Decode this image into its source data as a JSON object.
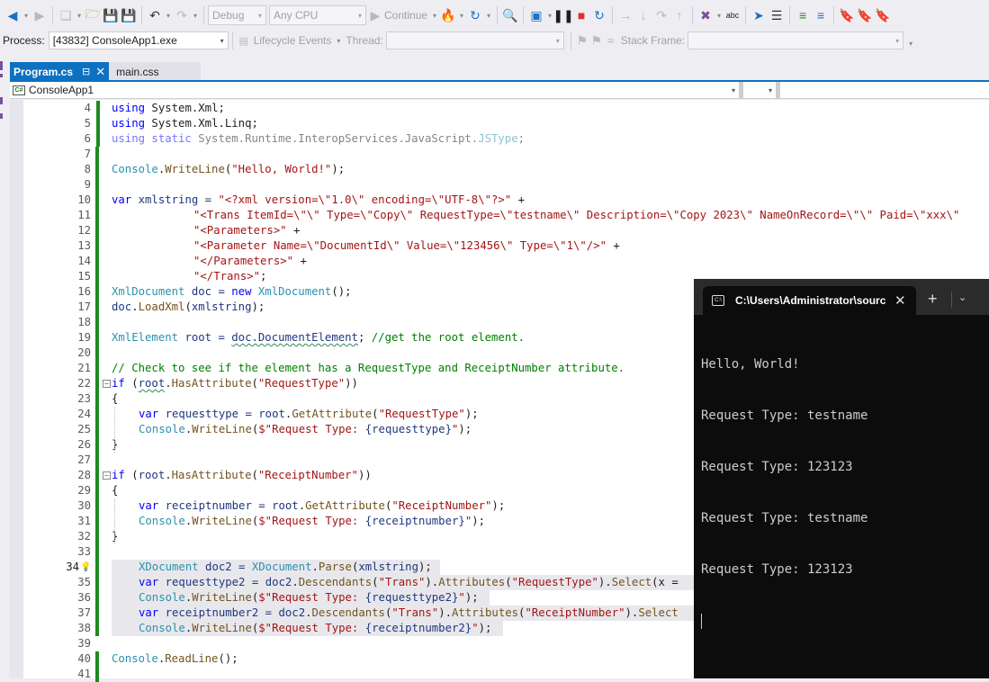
{
  "toolbar": {
    "configuration": "Debug",
    "platform": "Any CPU",
    "continue_label": "Continue"
  },
  "debugbar": {
    "process_label": "Process:",
    "process_value": "[43832] ConsoleApp1.exe",
    "lifecycle_label": "Lifecycle Events",
    "thread_label": "Thread:",
    "thread_value": "",
    "stackframe_label": "Stack Frame:",
    "stackframe_value": ""
  },
  "tabs": [
    {
      "label": "Program.cs",
      "active": true
    },
    {
      "label": "main.css",
      "active": false
    }
  ],
  "navbar": {
    "project": "ConsoleApp1",
    "type_member": "",
    "member": ""
  },
  "editor": {
    "lines": [
      {
        "n": "4"
      },
      {
        "n": "5"
      },
      {
        "n": "6"
      },
      {
        "n": "7"
      },
      {
        "n": "8"
      },
      {
        "n": "9"
      },
      {
        "n": "10"
      },
      {
        "n": "11"
      },
      {
        "n": "12"
      },
      {
        "n": "13"
      },
      {
        "n": "14"
      },
      {
        "n": "15"
      },
      {
        "n": "16"
      },
      {
        "n": "17"
      },
      {
        "n": "18"
      },
      {
        "n": "19"
      },
      {
        "n": "20"
      },
      {
        "n": "21"
      },
      {
        "n": "22"
      },
      {
        "n": "23"
      },
      {
        "n": "24"
      },
      {
        "n": "25"
      },
      {
        "n": "26"
      },
      {
        "n": "27"
      },
      {
        "n": "28"
      },
      {
        "n": "29"
      },
      {
        "n": "30"
      },
      {
        "n": "31"
      },
      {
        "n": "32"
      },
      {
        "n": "33"
      },
      {
        "n": "34"
      },
      {
        "n": "35"
      },
      {
        "n": "36"
      },
      {
        "n": "37"
      },
      {
        "n": "38"
      },
      {
        "n": "39"
      },
      {
        "n": "40"
      },
      {
        "n": "41"
      }
    ],
    "code": {
      "l4": [
        "using",
        " System.Xml;"
      ],
      "l5": [
        "using",
        " System.Xml.Linq;"
      ],
      "l6": [
        "using static",
        " System.Runtime.InteropServices.JavaScript.",
        "JSType",
        ";"
      ],
      "l8": [
        "Console",
        ".",
        "WriteLine",
        "(",
        "\"Hello, World!\"",
        ");"
      ],
      "l10": [
        "var",
        " xmlstring = ",
        "\"<?xml version=\\\"1.0\\\" encoding=\\\"UTF-8\\\"?>\"",
        " +"
      ],
      "l11": [
        "\"<Trans ItemId=\\\"\\\" Type=\\\"Copy\\\" RequestType=\\\"testname\\\" Description=\\\"Copy 2023\\\" NameOnRecord=\\\"\\\" Paid=\\\"xxx\\\""
      ],
      "l12": [
        "\"<Parameters>\"",
        " +"
      ],
      "l13": [
        "\"<Parameter Name=\\\"DocumentId\\\" Value=\\\"123456\\\" Type=\\\"1\\\"/>\"",
        " +"
      ],
      "l14": [
        "\"</Parameters>\"",
        " +"
      ],
      "l15": [
        "\"</Trans>\"",
        ";"
      ],
      "l16": [
        "XmlDocument",
        " doc = ",
        "new",
        " ",
        "XmlDocument",
        "();"
      ],
      "l17": [
        "doc",
        ".",
        "LoadXml",
        "(",
        "xmlstring",
        ");"
      ],
      "l19": [
        "XmlElement",
        " root = ",
        "doc.DocumentElement",
        "; ",
        "//get the root element."
      ],
      "l21": [
        "// Check to see if the element has a RequestType and ReceiptNumber attribute."
      ],
      "l22": [
        "if",
        " (",
        "root",
        ".",
        "HasAttribute",
        "(",
        "\"RequestType\"",
        "))"
      ],
      "l23": [
        "{"
      ],
      "l24": [
        "var",
        " requesttype = ",
        "root",
        ".",
        "GetAttribute",
        "(",
        "\"RequestType\"",
        ");"
      ],
      "l25": [
        "Console",
        ".",
        "WriteLine",
        "(",
        "$\"Request Type: ",
        "{requesttype}",
        "\"",
        ");"
      ],
      "l26": [
        "}"
      ],
      "l28": [
        "if",
        " (",
        "root",
        ".",
        "HasAttribute",
        "(",
        "\"ReceiptNumber\"",
        "))"
      ],
      "l29": [
        "{"
      ],
      "l30": [
        "var",
        " receiptnumber = ",
        "root",
        ".",
        "GetAttribute",
        "(",
        "\"ReceiptNumber\"",
        ");"
      ],
      "l31": [
        "Console",
        ".",
        "WriteLine",
        "(",
        "$\"Request Type: ",
        "{receiptnumber}",
        "\"",
        ");"
      ],
      "l32": [
        "}"
      ],
      "l34": [
        "XDocument",
        " doc2 = ",
        "XDocument",
        ".",
        "Parse",
        "(",
        "xmlstring",
        ");"
      ],
      "l35": [
        "var",
        " requesttype2 = ",
        "doc2",
        ".",
        "Descendants",
        "(",
        "\"Trans\"",
        ").",
        "Attributes",
        "(",
        "\"RequestType\"",
        ").",
        "Select",
        "(x ="
      ],
      "l36": [
        "Console",
        ".",
        "WriteLine",
        "(",
        "$\"Request Type: ",
        "{requesttype2}",
        "\"",
        ");"
      ],
      "l37": [
        "var",
        " receiptnumber2 = ",
        "doc2",
        ".",
        "Descendants",
        "(",
        "\"Trans\"",
        ").",
        "Attributes",
        "(",
        "\"ReceiptNumber\"",
        ").",
        "Select"
      ],
      "l38": [
        "Console",
        ".",
        "WriteLine",
        "(",
        "$\"Request Type: ",
        "{receiptnumber2}",
        "\"",
        ");"
      ],
      "l40": [
        "Console",
        ".",
        "ReadLine",
        "();"
      ]
    }
  },
  "terminal": {
    "title": "C:\\Users\\Administrator\\source",
    "output": [
      "Hello, World!",
      "Request Type: testname",
      "Request Type: 123123",
      "Request Type: testname",
      "Request Type: 123123"
    ]
  },
  "colors": {
    "accent": "#0e70c0",
    "keyword": "#0000ff",
    "type": "#2b91af",
    "string": "#a31515",
    "comment": "#008000",
    "change_bar": "#1f8a1f",
    "terminal_bg": "#0c0c0c"
  }
}
